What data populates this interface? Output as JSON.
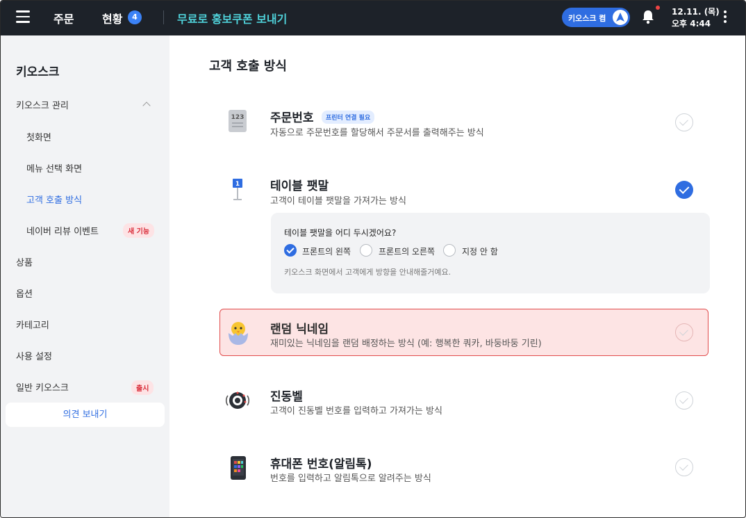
{
  "header": {
    "order_label": "주문",
    "status_label": "현황",
    "status_badge": "4",
    "promo_label": "무료로 홍보쿠폰 보내기",
    "kiosk_label": "키오스크 켬",
    "date": "12.11. (목)",
    "time": "오후 4:44"
  },
  "sidebar": {
    "title": "키오스크",
    "kiosk_manage": "키오스크 관리",
    "sub_items": [
      "첫화면",
      "메뉴 선택 화면",
      "고객 호출 방식",
      "네이버 리뷰 이벤트"
    ],
    "new_feature_tag": "새 기능",
    "items": [
      "상품",
      "옵션",
      "카테고리",
      "사용 설정",
      "일반 키오스크"
    ],
    "release_tag": "출시",
    "feedback": "의견 보내기"
  },
  "main": {
    "title": "고객 호출 방식",
    "options": [
      {
        "title": "주문번호",
        "desc": "자동으로 주문번호를 할당해서 주문서를 출력해주는 방식",
        "tag": "프린터 연결 필요",
        "checked": false,
        "icon": "order-number-icon"
      },
      {
        "title": "테이블 팻말",
        "desc": "고객이 테이블 팻말을 가져가는 방식",
        "checked": true,
        "icon": "table-sign-icon"
      },
      {
        "title": "랜덤 닉네임",
        "desc": "재미있는 닉네임을 랜덤 배정하는 방식 (예: 행복한 쿼카, 바둥바둥 기린)",
        "checked": false,
        "icon": "chick-icon"
      },
      {
        "title": "진동벨",
        "desc": "고객이 진동벨 번호를 입력하고 가져가는 방식",
        "checked": false,
        "icon": "vibration-bell-icon"
      },
      {
        "title": "휴대폰 번호(알림톡)",
        "desc": "번호를 입력하고 알림톡으로 알려주는 방식",
        "checked": false,
        "icon": "phone-icon"
      }
    ],
    "placement": {
      "question": "테이블 팻말을 어디 두시겠어요?",
      "choices": [
        "프론트의 왼쪽",
        "프론트의 오른쪽",
        "지정 안 함"
      ],
      "selected": "프론트의 왼쪽",
      "note": "키오스크 화면에서 고객에게 방향을 안내해줄거예요."
    }
  },
  "colors": {
    "accent": "#2f6de1",
    "header_bg": "#1d2229",
    "promo": "#4fd1d9",
    "highlight_border": "#e14a4a"
  }
}
